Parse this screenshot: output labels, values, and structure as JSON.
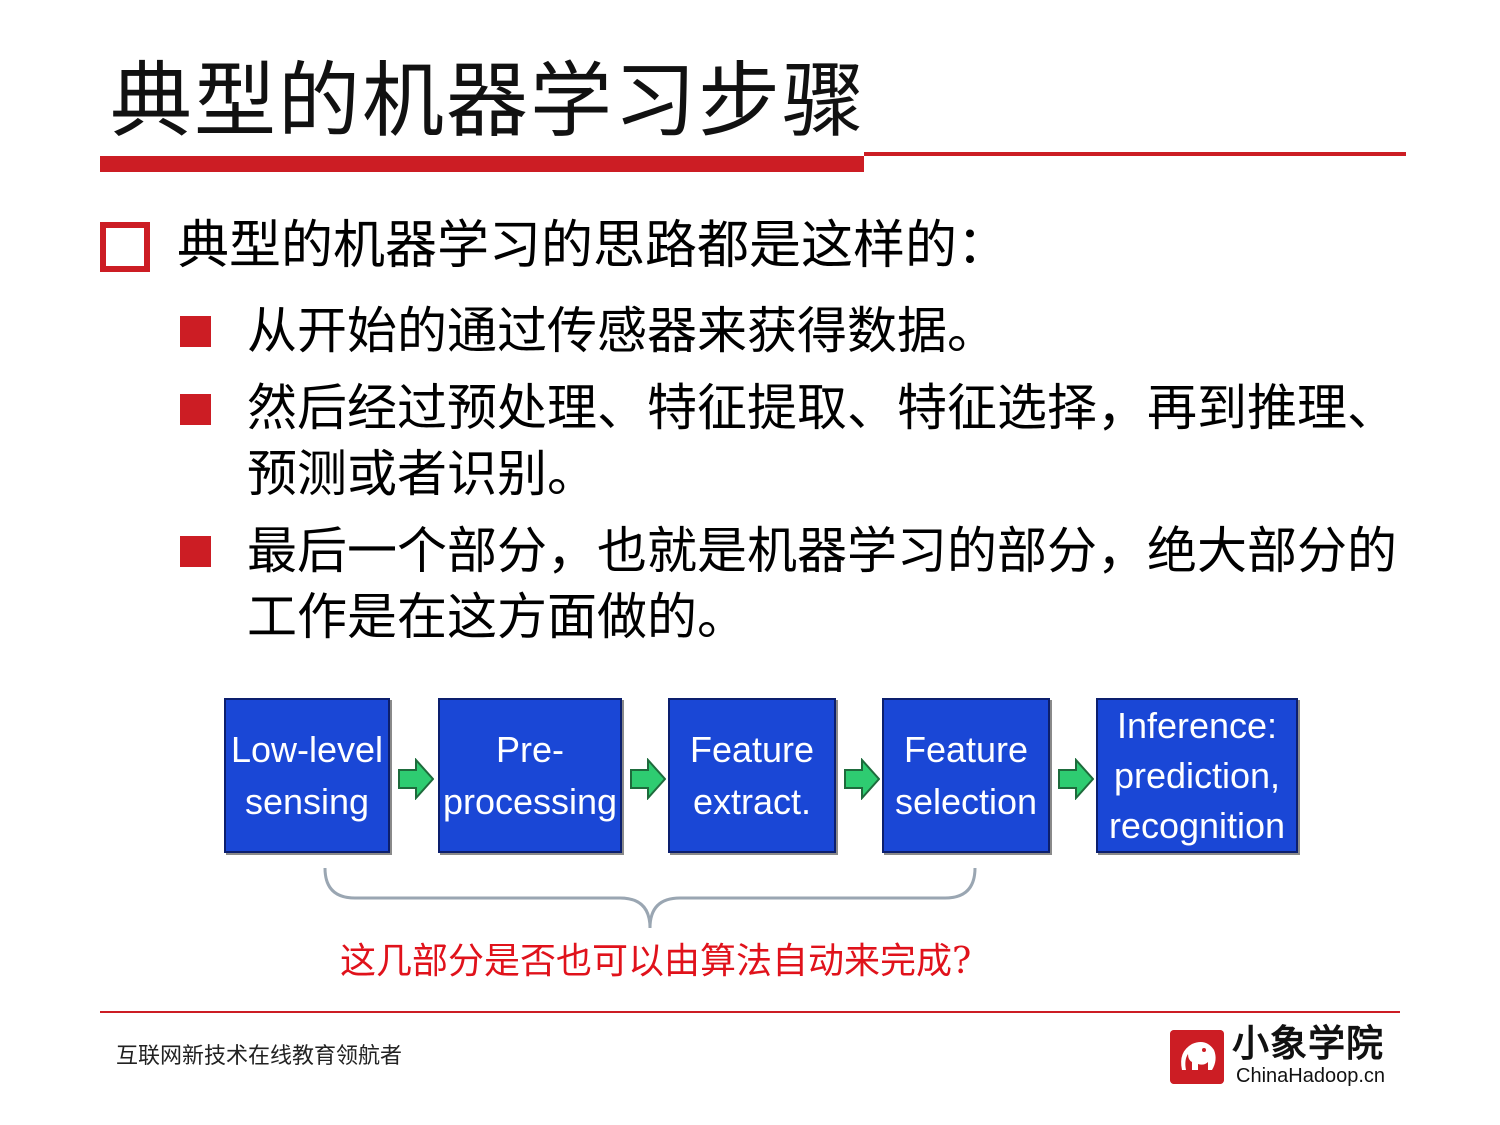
{
  "slide": {
    "title": "典型的机器学习步骤",
    "bullet_main": "典型的机器学习的思路都是这样的：",
    "sub_bullets": [
      "从开始的通过传感器来获得数据。",
      "然后经过预处理、特征提取、特征选择，再到推理、预测或者识别。",
      "最后一个部分，也就是机器学习的部分，绝大部分的工作是在这方面做的。"
    ]
  },
  "diagram": {
    "steps": [
      "Low-level\nsensing",
      "Pre-\nprocessing",
      "Feature\nextract.",
      "Feature\nselection",
      "Inference:\nprediction,\nrecognition"
    ],
    "question": "这几部分是否也可以由算法自动来完成?"
  },
  "footer": {
    "tagline": "互联网新技术在线教育领航者",
    "logo_name": "小象学院",
    "logo_site": "ChinaHadoop.cn"
  },
  "colors": {
    "accent": "#cc1d24",
    "box_blue": "#1a47d6",
    "arrow_green": "#2ecc71",
    "question_red": "#e0121b"
  }
}
